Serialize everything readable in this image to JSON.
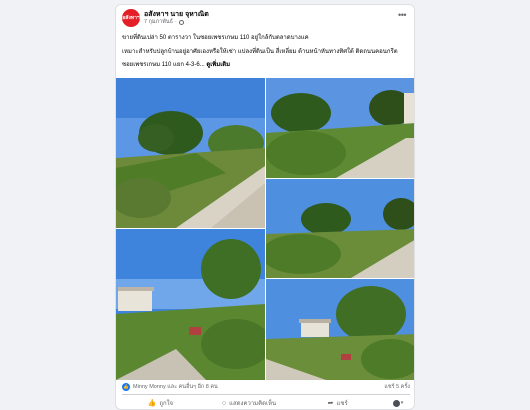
{
  "post": {
    "author": "อสังหาฯ นาย จุหาณิต",
    "avatar_text": "อสังหาฯ",
    "timestamp": "7 กุมภาพันธ์",
    "paragraphs": [
      "ขายที่ดินเปล่า 50 ตารางวา ในซอยเพชรเกษม 110 อยู่ใกล้กับตลาดบางแค",
      "เหมาะสำหรับปลูกบ้านอยู่อาศัยเองหรือให้เช่า แปลงที่ดินเป็น สี่เหลี่ยม ด้านหน้าหันทางทิศใต้ ติดถนนคอนกรีต",
      "ซอยเพชรเกษม 110 แยก 4-3-6..."
    ],
    "see_more": "ดูเพิ่มเติม"
  },
  "photos": [
    {
      "name": "photo-1",
      "label": "empty lot with trees and road"
    },
    {
      "name": "photo-2",
      "label": "road with roadside trees"
    },
    {
      "name": "photo-3",
      "label": "overgrown lot with trees"
    },
    {
      "name": "photo-4",
      "label": "lot with house and sign"
    },
    {
      "name": "photo-5",
      "label": "road with house and trees"
    }
  ],
  "reactions": {
    "like_icon": "like-icon",
    "text": "Minny Monny และ คนอื่นๆ อีก 8 คน",
    "shares": "แชร์ 5 ครั้ง"
  },
  "actions": {
    "like": "ถูกใจ",
    "comment": "แสดงความคิดเห็น",
    "share": "แชร์"
  },
  "colors": {
    "brand_red": "#e41e26",
    "facebook_blue": "#1877f2",
    "sky": "#4f8fe0",
    "foliage": "#3f7a2a"
  }
}
